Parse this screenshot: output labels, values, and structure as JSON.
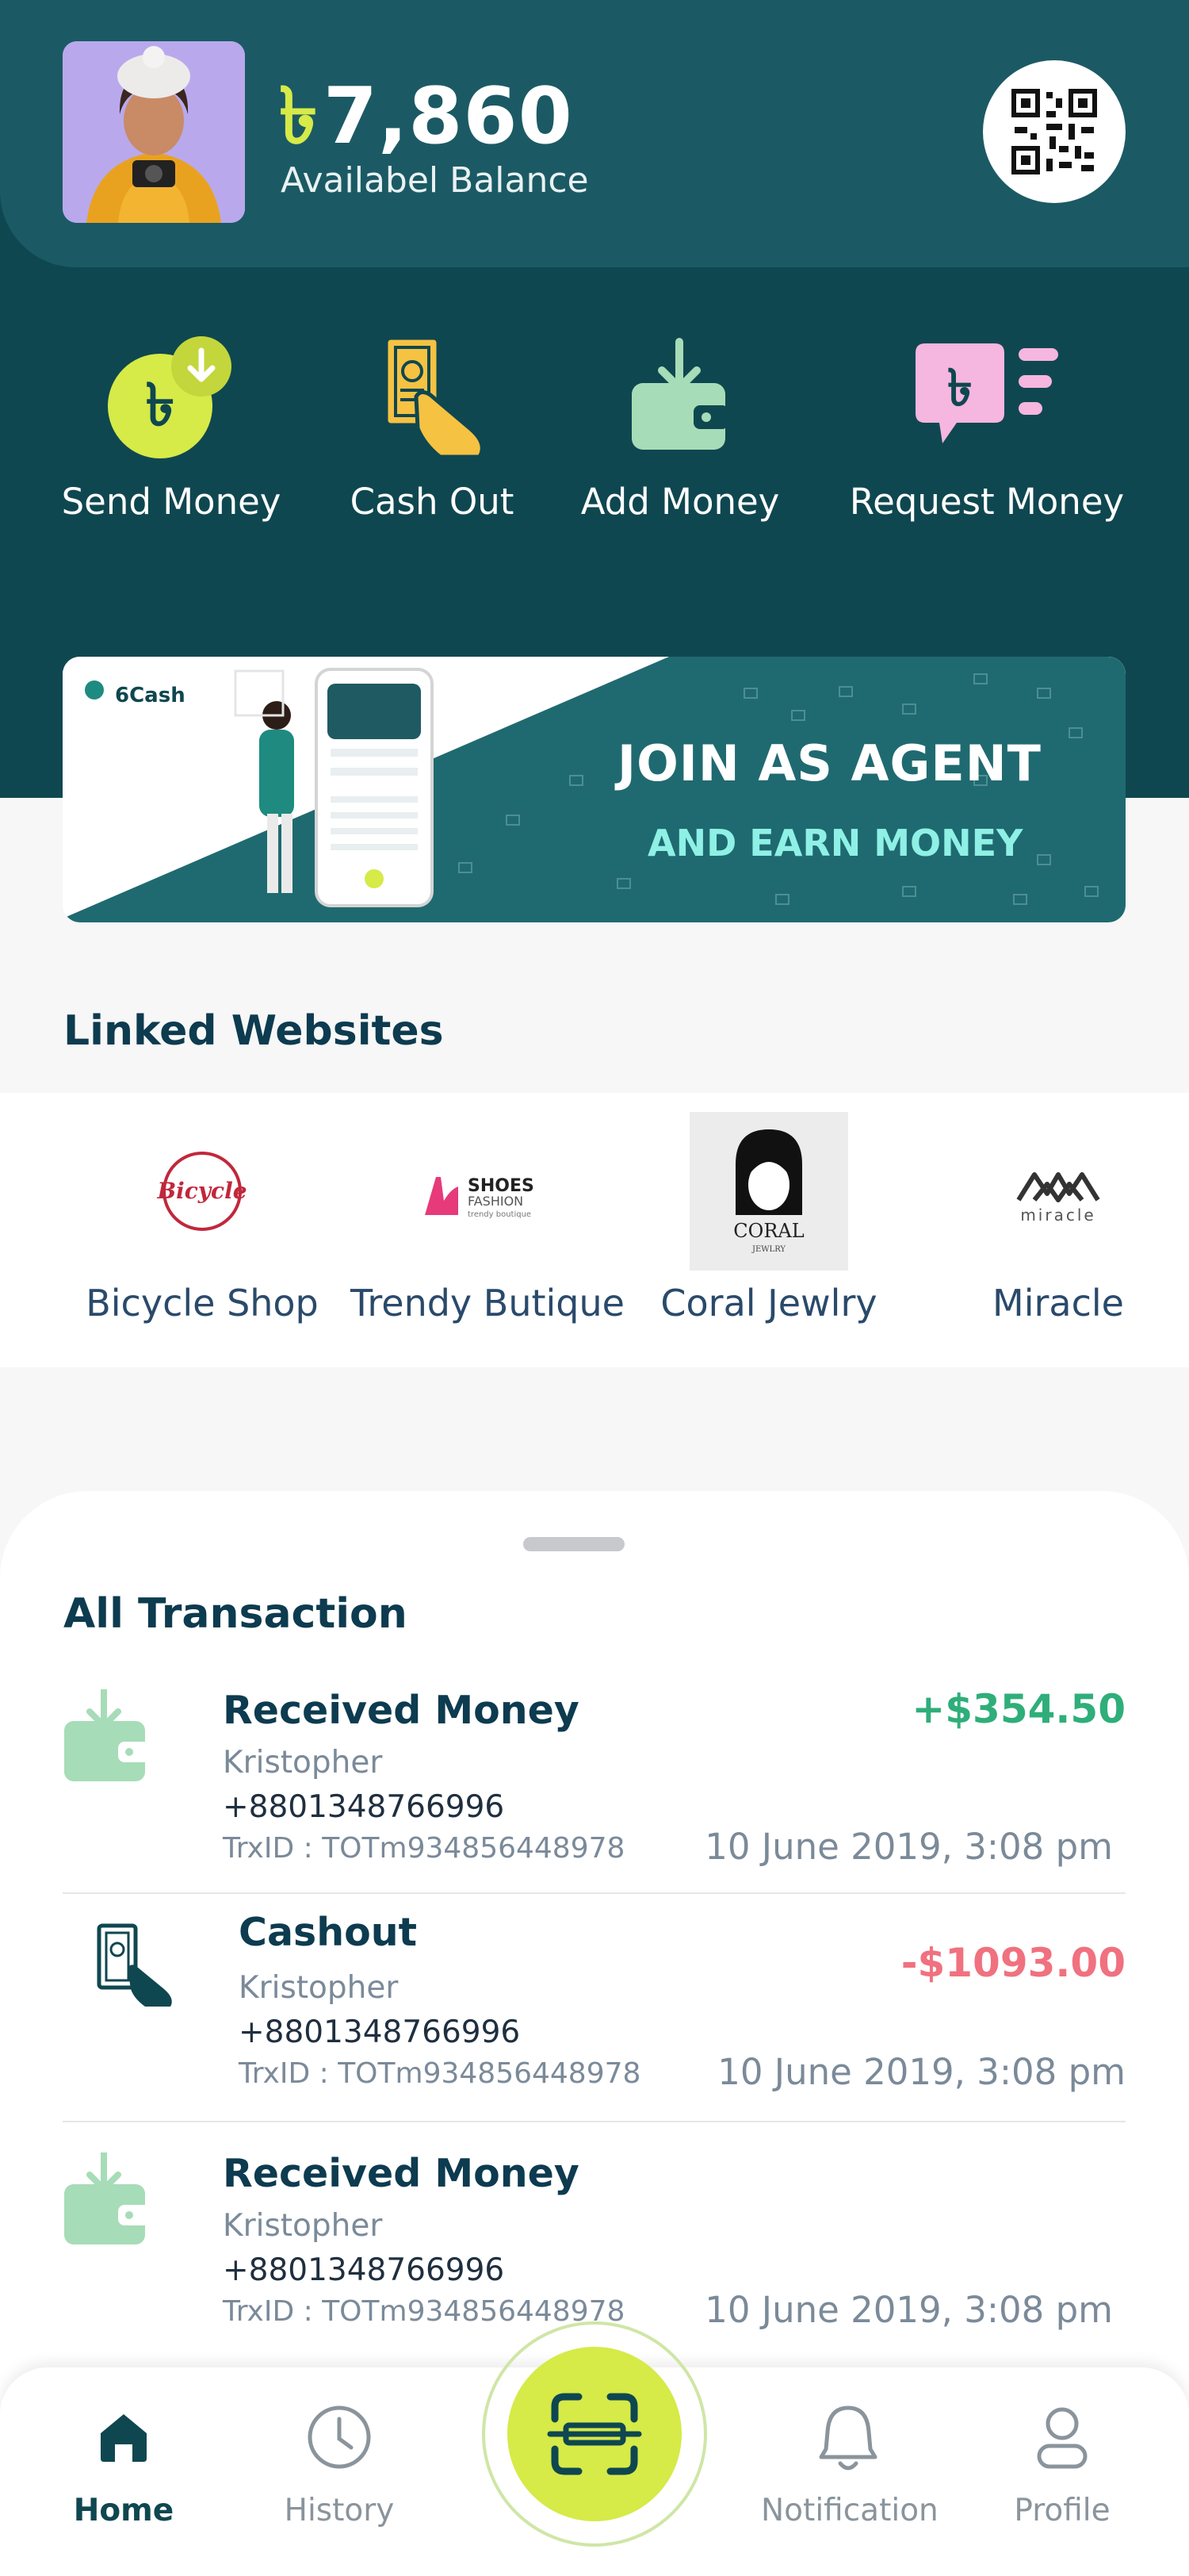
{
  "header": {
    "currency_symbol": "৳",
    "balance": "7,860",
    "balance_label": "Availabel Balance"
  },
  "actions": [
    {
      "label": "Send Money",
      "icon": "send-money-icon"
    },
    {
      "label": "Cash Out",
      "icon": "cash-out-icon"
    },
    {
      "label": "Add Money",
      "icon": "add-money-icon"
    },
    {
      "label": "Request Money",
      "icon": "request-money-icon"
    }
  ],
  "banner": {
    "brand": "6Cash",
    "title": "JOIN AS AGENT",
    "subtitle": "AND EARN MONEY"
  },
  "linked_websites": {
    "title": "Linked Websites",
    "sites": [
      {
        "name": "Bicycle Shop",
        "logo_text": "Bicycle"
      },
      {
        "name": "Trendy Butique",
        "logo_text": "SHOES",
        "logo_sub": "FASHION",
        "logo_tag": "trendy boutique"
      },
      {
        "name": "Coral Jewlry",
        "logo_text": "CORAL",
        "logo_sub": "JEWLRY"
      },
      {
        "name": "Miracle",
        "logo_text": "miracle"
      }
    ]
  },
  "transactions": {
    "title": "All Transaction",
    "items": [
      {
        "type": "Received Money",
        "name": "Kristopher",
        "phone": "+8801348766996",
        "trx_id": "TrxID : TOTm934856448978",
        "amount": "+$354.50",
        "date": "10 June 2019, 3:08 pm",
        "icon": "received-money-icon"
      },
      {
        "type": "Cashout",
        "name": "Kristopher",
        "phone": "+8801348766996",
        "trx_id": "TrxID : TOTm934856448978",
        "amount": "-$1093.00",
        "date": "10 June 2019, 3:08 pm",
        "icon": "cashout-icon"
      },
      {
        "type": "Received Money",
        "name": "Kristopher",
        "phone": "+8801348766996",
        "trx_id": "TrxID : TOTm934856448978",
        "amount": "",
        "date": "10 June 2019, 3:08 pm",
        "icon": "received-money-icon"
      }
    ]
  },
  "nav": {
    "items": [
      {
        "label": "Home",
        "icon": "home-icon",
        "active": true
      },
      {
        "label": "History",
        "icon": "history-icon",
        "active": false
      },
      {
        "label": "Notification",
        "icon": "bell-icon",
        "active": false
      },
      {
        "label": "Profile",
        "icon": "profile-icon",
        "active": false
      }
    ],
    "center_icon": "scan-icon"
  },
  "colors": {
    "primary_dark": "#0f4750",
    "accent_lime": "#d6ea48",
    "positive": "#2fae7a",
    "negative": "#f0717f",
    "mint": "#a7dcb8",
    "pink": "#f5b6df",
    "gold": "#f5c242"
  }
}
